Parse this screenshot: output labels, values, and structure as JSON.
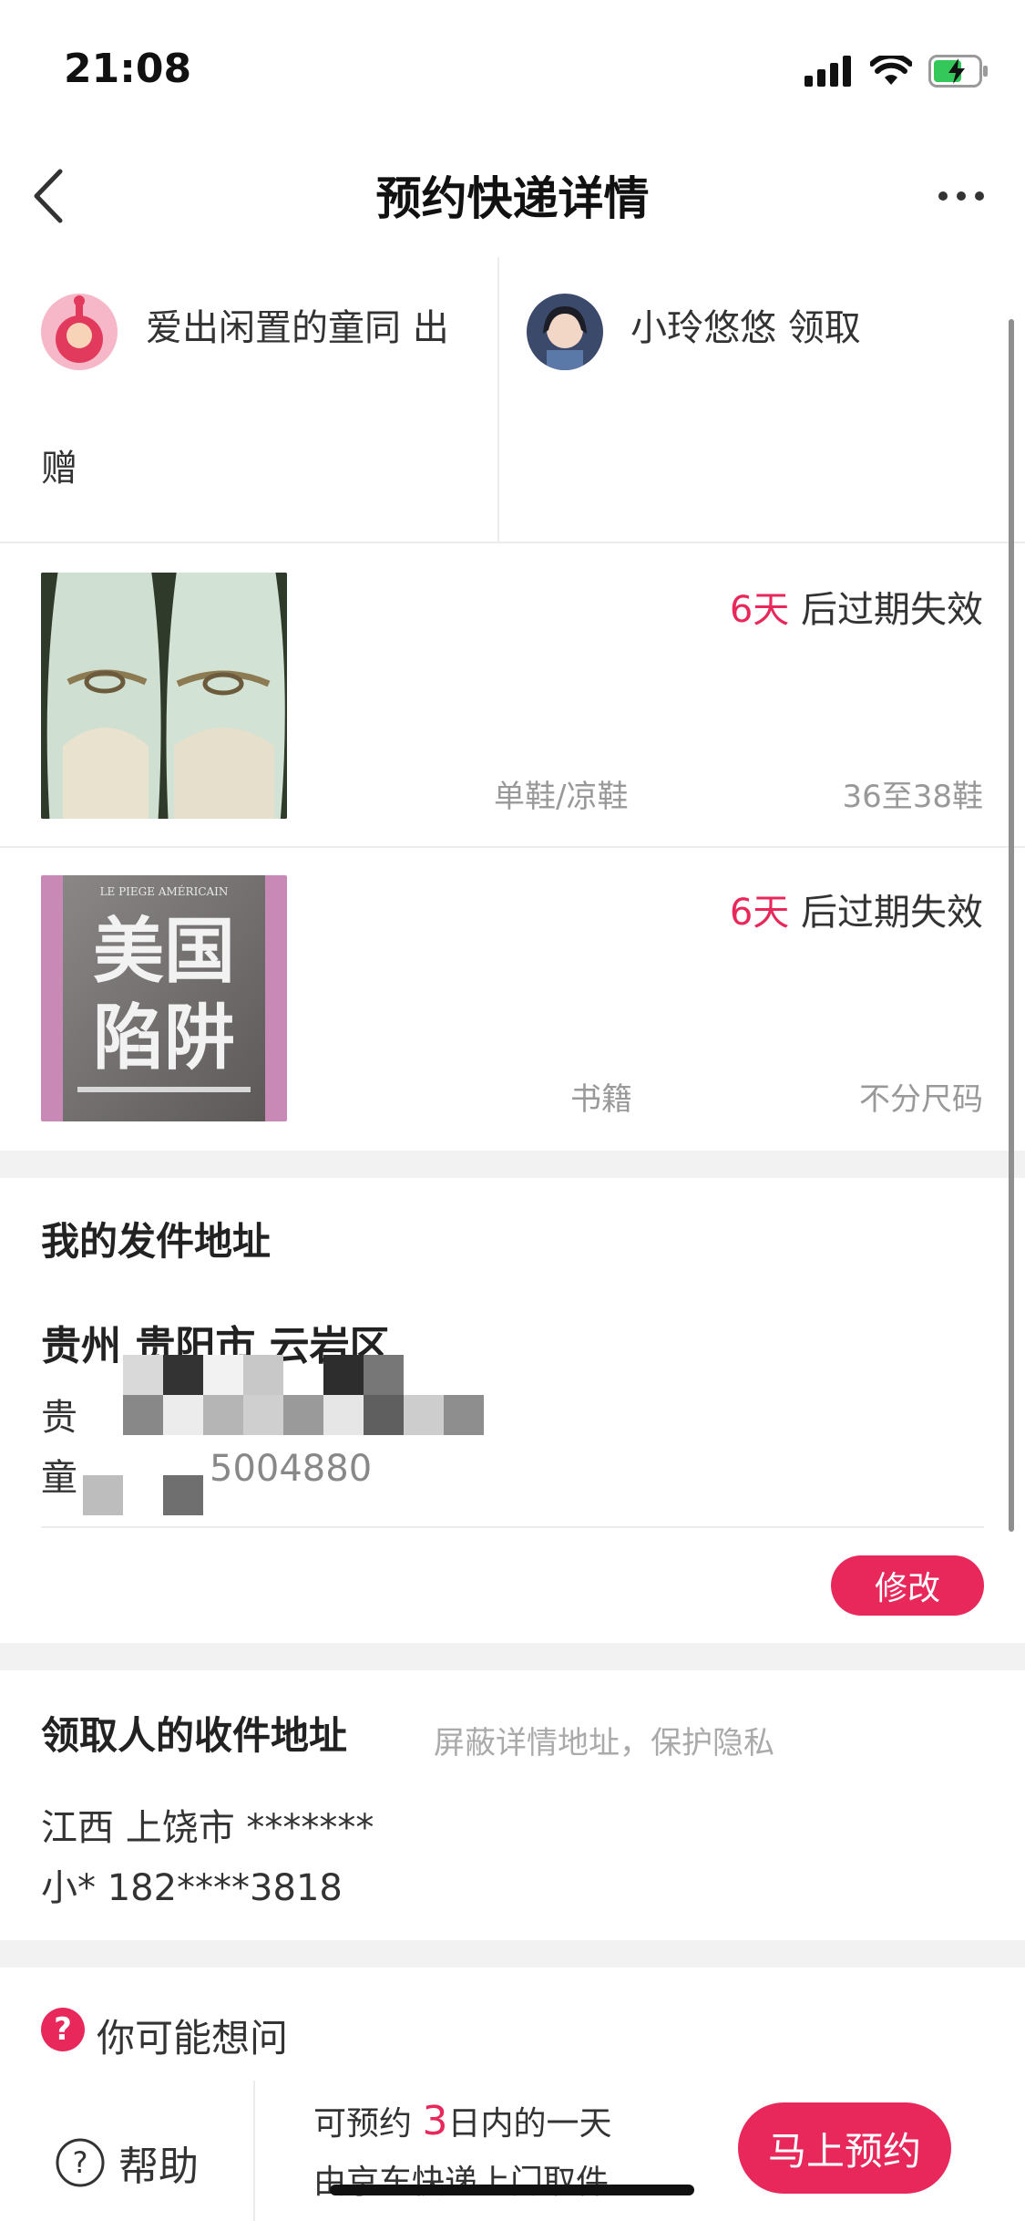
{
  "status_bar": {
    "time": "21:08"
  },
  "nav": {
    "title": "预约快递详情"
  },
  "giver": {
    "name_line1": "爱出闲置的童同 出",
    "name_line2": "赠"
  },
  "receiver": {
    "name": "小玲悠悠 领取"
  },
  "items": [
    {
      "days": "6天",
      "expire_suffix": " 后过期失效",
      "category": "单鞋/凉鞋",
      "size": "36至38鞋"
    },
    {
      "days": "6天",
      "expire_suffix": " 后过期失效",
      "category": "书籍",
      "size": "不分尺码",
      "book_title_top": "美国",
      "book_title_bottom": "陷阱",
      "book_header": "LE PIEGE AMÉRICAIN"
    }
  ],
  "my_address": {
    "title": "我的发件地址",
    "region": "贵州 贵阳市 云岩区",
    "line2_prefix": "贵",
    "line3_prefix": "童",
    "line3_tail": "5004880",
    "edit_label": "修改"
  },
  "receiver_address": {
    "title": "领取人的收件地址",
    "privacy_note": "屏蔽详情地址，保护隐私",
    "region": "江西 上饶市 *******",
    "contact": "小* 182****3818"
  },
  "faq": {
    "icon_char": "?",
    "label": "你可能想问"
  },
  "bottom": {
    "help_label": "帮助",
    "info_prefix": "可预约 ",
    "info_number": "3",
    "info_suffix": "日内的一天",
    "info_line2": "由京东快递上门取件",
    "book_label": "马上预约"
  },
  "colors": {
    "accent": "#e8285a",
    "divider": "#ececec",
    "section_gap": "#f2f2f2"
  }
}
